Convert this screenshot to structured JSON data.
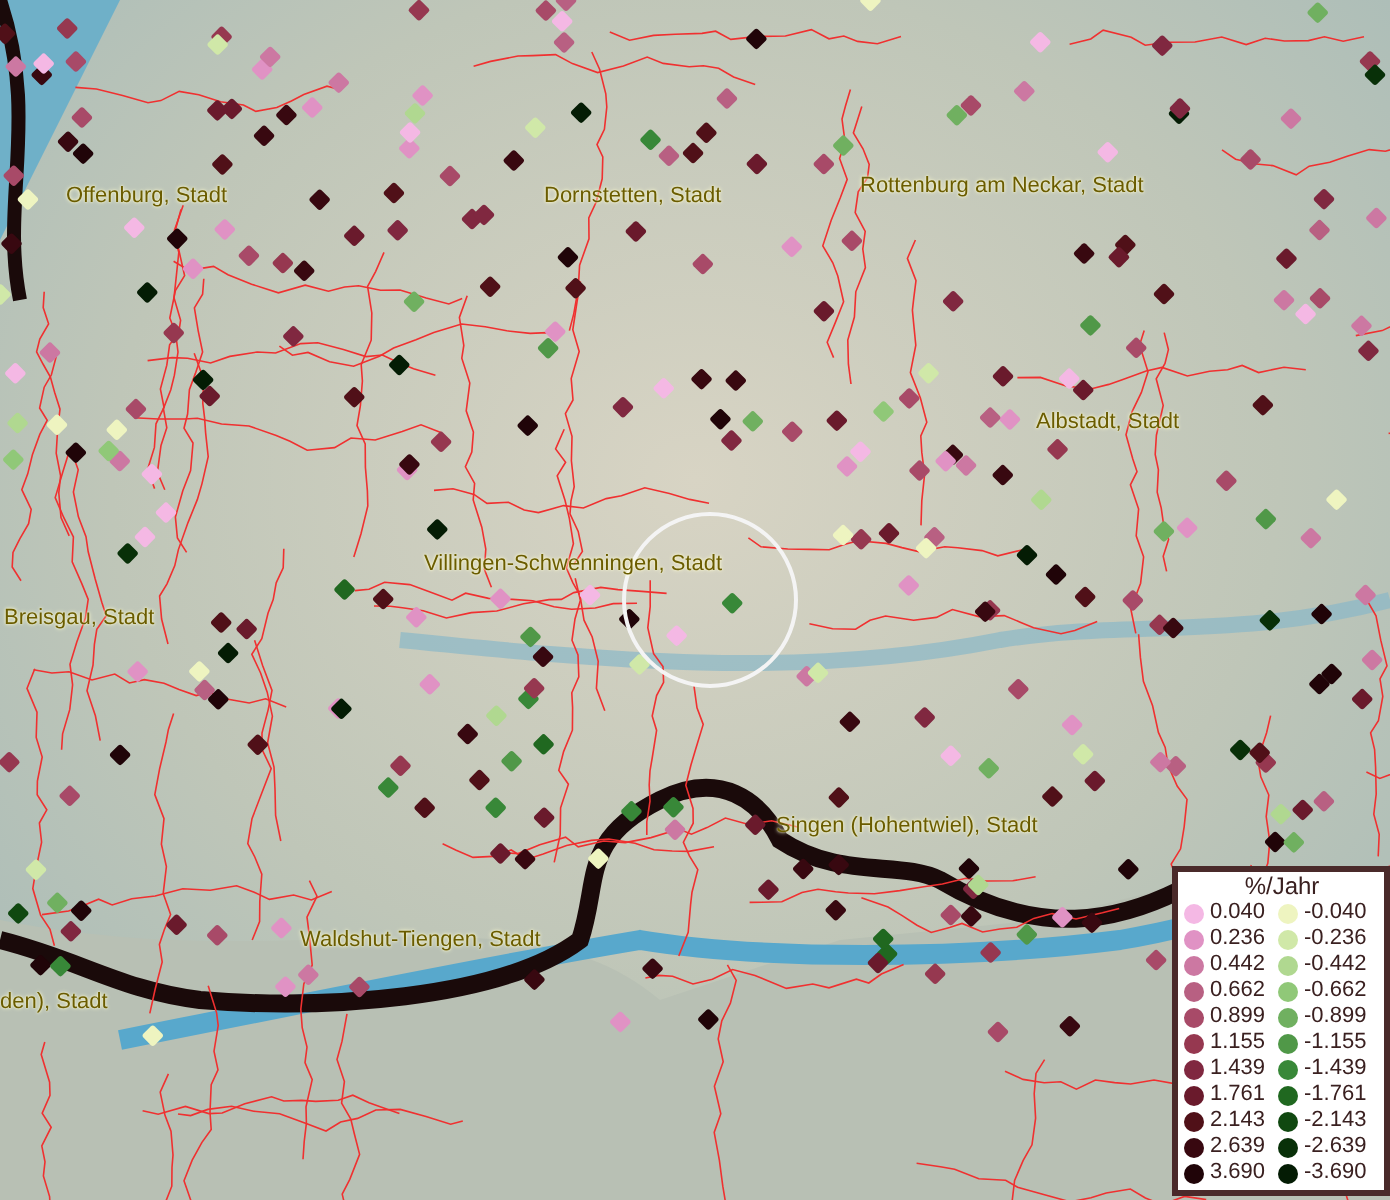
{
  "map": {
    "labels": [
      {
        "text": "Offenburg, Stadt"
      },
      {
        "text": "Dornstetten, Stadt"
      },
      {
        "text": "Rottenburg am Neckar, Stadt"
      },
      {
        "text": "Albstadt, Stadt"
      },
      {
        "text": "Villingen-Schwenningen, Stadt"
      },
      {
        "text": "Breisgau, Stadt"
      },
      {
        "text": "Singen (Hohentwiel), Stadt"
      },
      {
        "text": "Waldshut-Tiengen, Stadt"
      },
      {
        "text": "den), Stadt"
      }
    ]
  },
  "legend": {
    "title": "%/Jahr",
    "positive": [
      {
        "value": "0.040",
        "color": "#f4b8e4"
      },
      {
        "value": "0.236",
        "color": "#e092c4"
      },
      {
        "value": "0.442",
        "color": "#cc78a2"
      },
      {
        "value": "0.662",
        "color": "#b86082"
      },
      {
        "value": "0.899",
        "color": "#a84a68"
      },
      {
        "value": "1.155",
        "color": "#963850"
      },
      {
        "value": "1.439",
        "color": "#802840"
      },
      {
        "value": "1.761",
        "color": "#6a1a2c"
      },
      {
        "value": "2.143",
        "color": "#501018"
      },
      {
        "value": "2.639",
        "color": "#380810"
      },
      {
        "value": "3.690",
        "color": "#200408"
      }
    ],
    "negative": [
      {
        "value": "-0.040",
        "color": "#eef4c0"
      },
      {
        "value": "-0.236",
        "color": "#d0e8a8"
      },
      {
        "value": "-0.442",
        "color": "#b0d890"
      },
      {
        "value": "-0.662",
        "color": "#90c878"
      },
      {
        "value": "-0.899",
        "color": "#70b060"
      },
      {
        "value": "-1.155",
        "color": "#509848"
      },
      {
        "value": "-1.439",
        "color": "#388838"
      },
      {
        "value": "-1.761",
        "color": "#206820"
      },
      {
        "value": "-2.143",
        "color": "#104810"
      },
      {
        "value": "-2.639",
        "color": "#083008"
      },
      {
        "value": "-3.690",
        "color": "#041c04"
      }
    ]
  }
}
